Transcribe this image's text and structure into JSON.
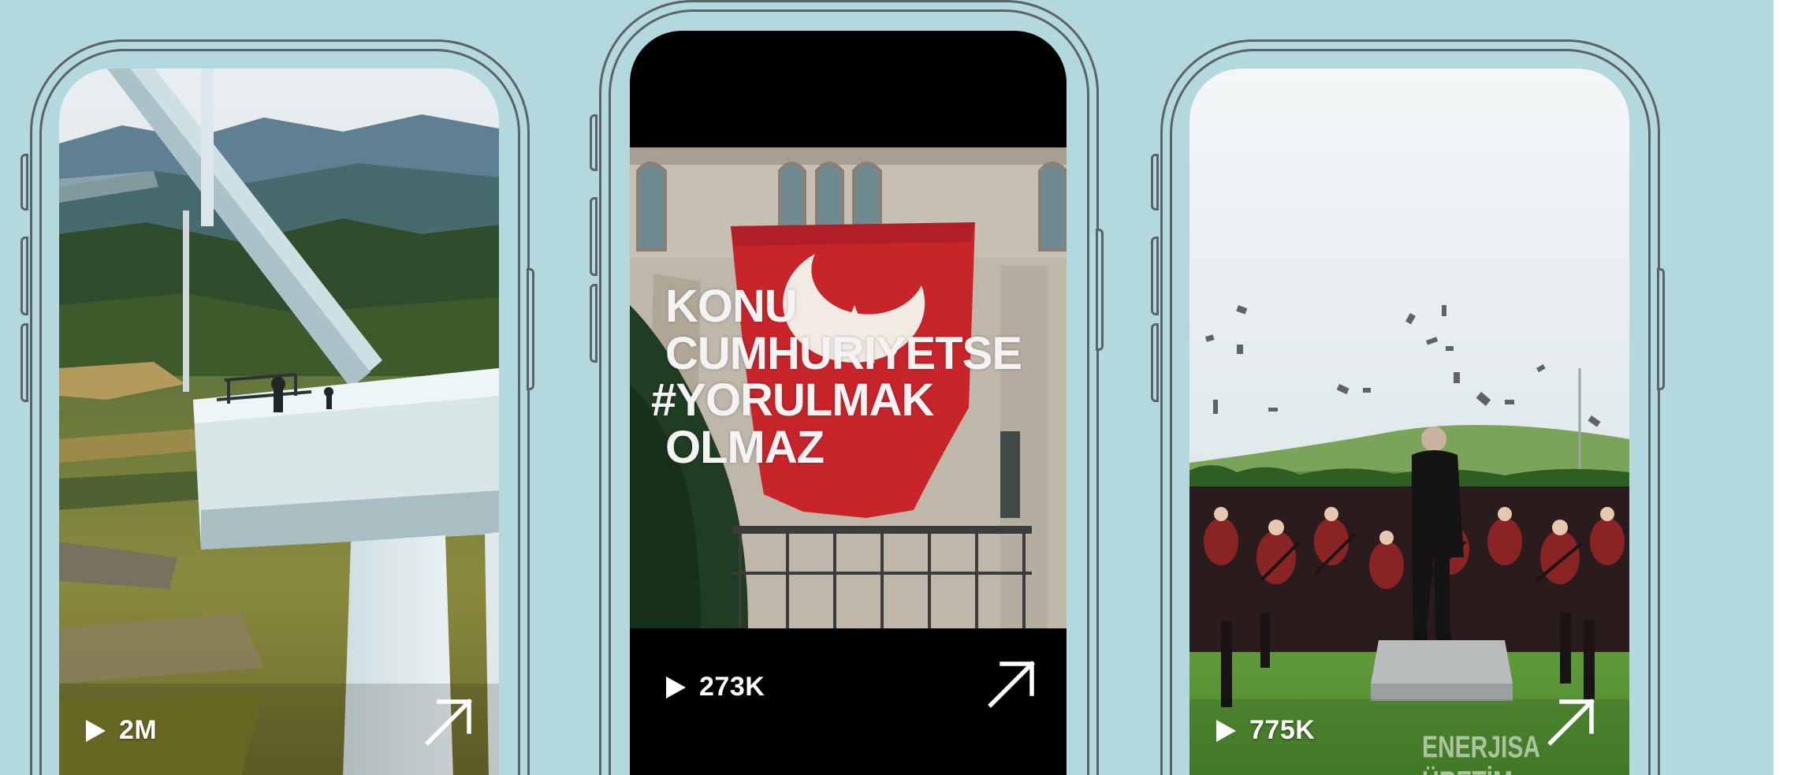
{
  "colors": {
    "background": "#b3d9df",
    "phone_outline": "#5a6367",
    "overlay_text": "#ffffff"
  },
  "cards": [
    {
      "views": "2M",
      "play_icon": "play-icon",
      "open_icon": "arrow-up-right-icon"
    },
    {
      "views": "273K",
      "play_icon": "play-icon",
      "open_icon": "arrow-up-right-icon",
      "overlay_lines": [
        "KONU",
        "CUMHURIYETSE",
        "#YORULMAK",
        "OLMAZ"
      ]
    },
    {
      "views": "775K",
      "play_icon": "play-icon",
      "open_icon": "arrow-up-right-icon",
      "watermark": "ENERJISA ÜRETİM"
    }
  ]
}
